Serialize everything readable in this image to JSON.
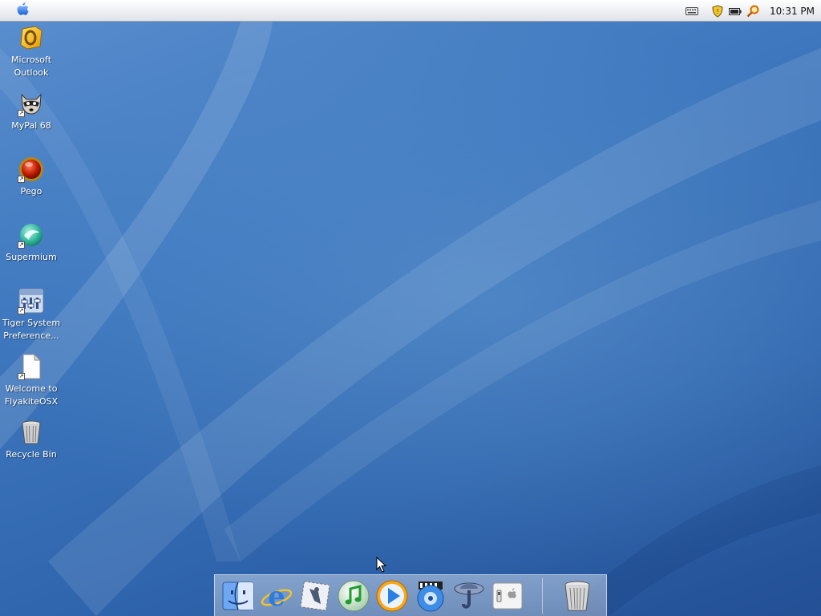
{
  "menubar": {
    "clock": "10:31 PM",
    "tray_icons": [
      "keyboard-icon",
      "security-shield-icon",
      "battery-icon",
      "search-icon"
    ]
  },
  "desktop": {
    "icons": [
      {
        "name": "microsoft-outlook",
        "label": "Microsoft\nOutlook",
        "icon": "outlook-icon"
      },
      {
        "name": "mypal-68",
        "label": "MyPal 68",
        "icon": "raccoon-icon"
      },
      {
        "name": "pego",
        "label": "Pego",
        "icon": "red-orb-icon"
      },
      {
        "name": "supermium",
        "label": "Supermium",
        "icon": "supermium-icon"
      },
      {
        "name": "tiger-system-preferences",
        "label": "Tiger System\nPreference...",
        "icon": "system-preferences-icon"
      },
      {
        "name": "welcome-to-flyakiteosx",
        "label": "Welcome to\nFlyakiteOSX",
        "icon": "document-icon"
      },
      {
        "name": "recycle-bin",
        "label": "Recycle Bin",
        "icon": "recycle-bin-icon"
      }
    ]
  },
  "dock": {
    "items": [
      "finder-icon",
      "internet-explorer-icon",
      "mail-icon",
      "itunes-icon",
      "quicktime-icon",
      "dvd-player-icon",
      "sherlock-icon",
      "system-preferences-icon",
      "trash-icon"
    ]
  },
  "colors": {
    "wallpaper_top": "#5a8fcf",
    "wallpaper_bottom": "#234f95",
    "menubar": "#eceef2"
  }
}
